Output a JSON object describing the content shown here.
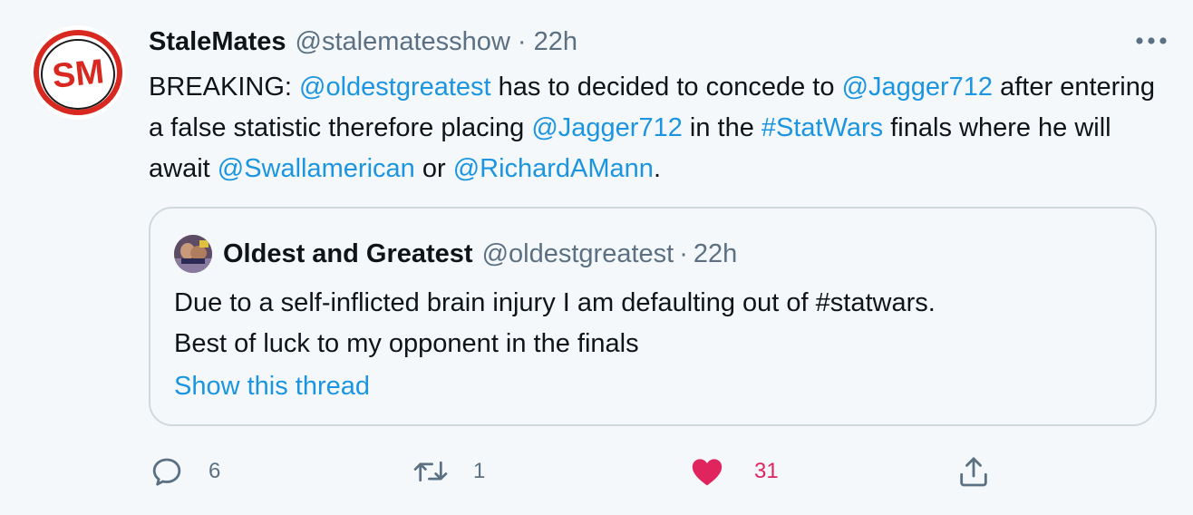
{
  "tweet": {
    "author_name": "StaleMates",
    "author_handle": "@stalematesshow",
    "separator": "·",
    "time": "22h",
    "avatar_text": "SM",
    "text": {
      "t0": "BREAKING: ",
      "m1": "@oldestgreatest",
      "t1": " has to decided to concede to ",
      "m2": "@Jagger712",
      "t2": " after entering a false statistic therefore placing ",
      "m3": "@Jagger712",
      "t3": " in the ",
      "h1": "#StatWars",
      "t4": " finals where he will await ",
      "m4": "@Swallamerican",
      "t5": " or ",
      "m5": "@RichardAMann",
      "t6": "."
    }
  },
  "quoted_tweet": {
    "author_name": "Oldest and Greatest",
    "author_handle": "@oldestgreatest",
    "separator": "·",
    "time": "22h",
    "text_line1": "Due to a self-inflicted brain injury I am defaulting out of #statwars.",
    "text_line2": "Best of luck to my opponent in the finals",
    "show_thread": "Show this thread"
  },
  "actions": {
    "replies": "6",
    "retweets": "1",
    "likes": "31"
  },
  "icons": {
    "more": "more-horizontal-icon",
    "reply": "reply-bubble-icon",
    "retweet": "retweet-icon",
    "like": "heart-icon",
    "share": "share-icon"
  },
  "colors": {
    "link": "#1b95e0",
    "secondary_text": "#5b7083",
    "like": "#e0245e",
    "background": "#f5f8fa"
  }
}
